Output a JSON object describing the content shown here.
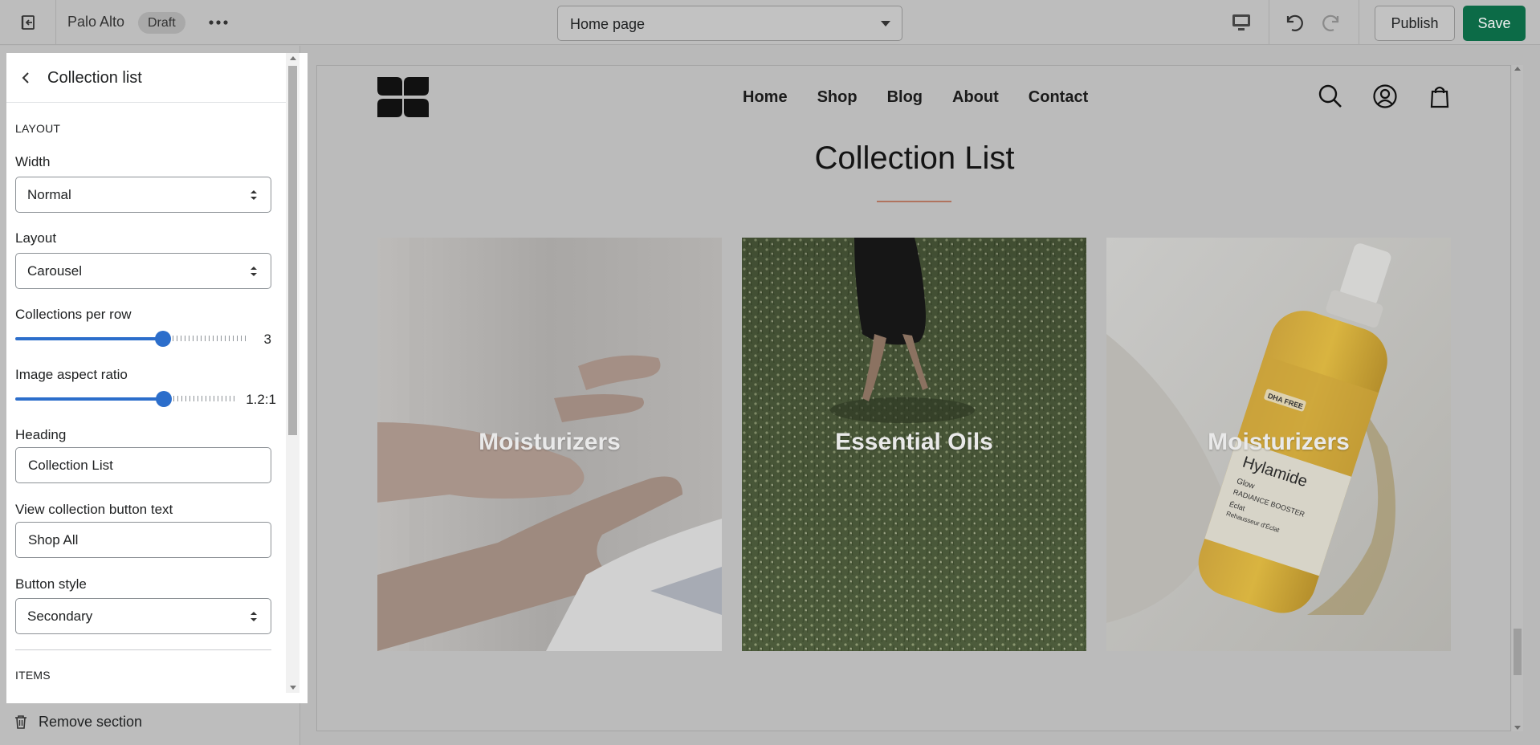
{
  "topbar": {
    "store_name": "Palo Alto",
    "status_badge": "Draft",
    "page_select": "Home page",
    "publish_label": "Publish",
    "save_label": "Save",
    "colors": {
      "save_bg": "#0c6b47"
    }
  },
  "panel": {
    "title": "Collection list",
    "layout_section": "LAYOUT",
    "width": {
      "label": "Width",
      "value": "Normal"
    },
    "layout": {
      "label": "Layout",
      "value": "Carousel"
    },
    "collections_per_row": {
      "label": "Collections per row",
      "value": "3",
      "level": 0.65
    },
    "image_aspect_ratio": {
      "label": "Image aspect ratio",
      "value": "1.2:1",
      "level": 0.68
    },
    "heading": {
      "label": "Heading",
      "value": "Collection List"
    },
    "view_button_text": {
      "label": "View collection button text",
      "value": "Shop All"
    },
    "button_style": {
      "label": "Button style",
      "value": "Secondary"
    },
    "items_section": "ITEMS",
    "remove_section": "Remove section",
    "colors": {
      "accent": "#2c6ecb"
    }
  },
  "preview": {
    "nav": [
      "Home",
      "Shop",
      "Blog",
      "About",
      "Contact"
    ],
    "heading": "Collection List",
    "collections": [
      {
        "label": "Moisturizers",
        "image": "hands-photo"
      },
      {
        "label": "Essential Oils",
        "image": "grass-field-photo"
      },
      {
        "label": "Moisturizers",
        "image": "serum-bottle-photo"
      }
    ],
    "bottle_label": {
      "tag": "DHA FREE",
      "brand": "Hylamide",
      "line1": "Glow",
      "line2": "RADIANCE BOOSTER",
      "line3": "Éclat",
      "line4": "Rehausseur d'Éclat"
    },
    "colors": {
      "underline": "#b0735e"
    }
  }
}
